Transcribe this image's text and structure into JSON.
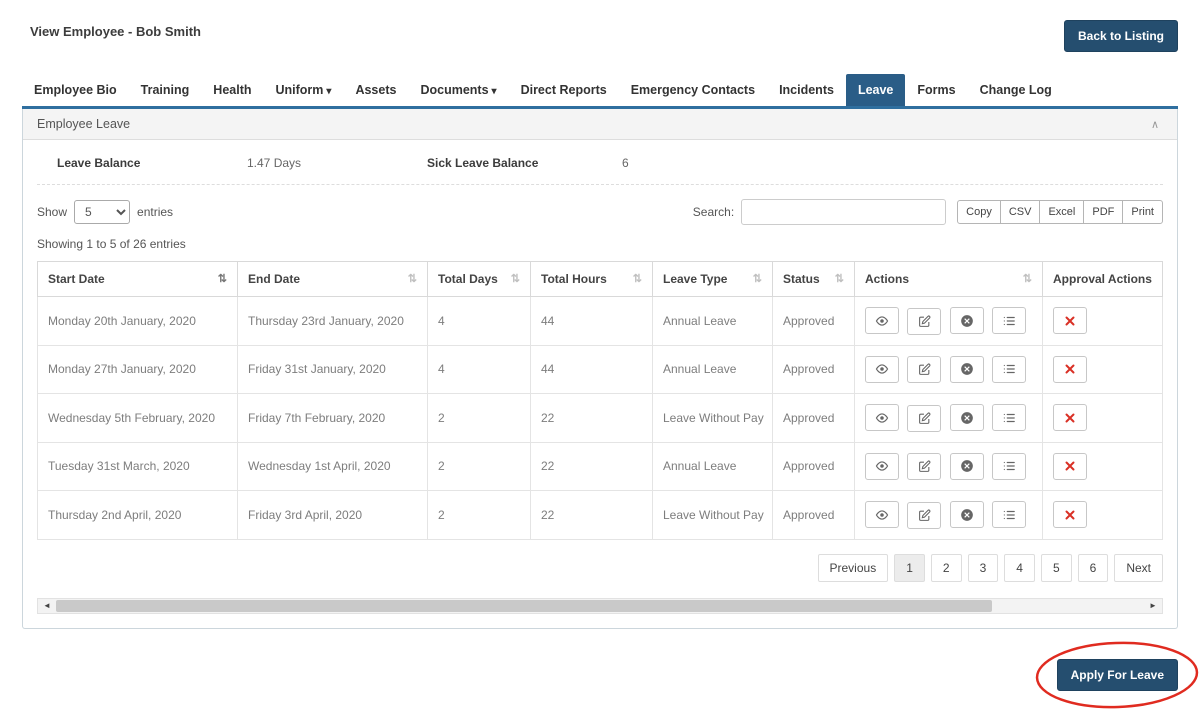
{
  "colors": {
    "navy": "#254e6f",
    "tab_active": "#2a5d87",
    "accent_blue": "#2f6f9f",
    "danger": "#d93025"
  },
  "icons": {
    "caret_down": "▾",
    "sort": "⇅",
    "collapse": "∧",
    "scroll_left": "◄",
    "scroll_right": "►"
  },
  "header": {
    "title": "View Employee - Bob Smith",
    "back_button": "Back to Listing"
  },
  "tabs": [
    {
      "label": "Employee Bio"
    },
    {
      "label": "Training"
    },
    {
      "label": "Health"
    },
    {
      "label": "Uniform"
    },
    {
      "label": "Assets"
    },
    {
      "label": "Documents"
    },
    {
      "label": "Direct Reports"
    },
    {
      "label": "Emergency Contacts"
    },
    {
      "label": "Incidents"
    },
    {
      "label": "Leave"
    },
    {
      "label": "Forms"
    },
    {
      "label": "Change Log"
    }
  ],
  "panel": {
    "title": "Employee Leave",
    "balances": {
      "leave_label": "Leave Balance",
      "leave_value": "1.47 Days",
      "sick_label": "Sick Leave Balance",
      "sick_value": "6"
    },
    "controls": {
      "show_label": "Show",
      "page_size": "5",
      "entries_label": "entries",
      "search_label": "Search:",
      "export_buttons": [
        "Copy",
        "CSV",
        "Excel",
        "PDF",
        "Print"
      ],
      "showing_text": "Showing 1 to 5 of 26 entries"
    },
    "table": {
      "headers": [
        "Start Date",
        "End Date",
        "Total Days",
        "Total Hours",
        "Leave Type",
        "Status",
        "Actions",
        "Approval Actions"
      ],
      "rows": [
        {
          "start_date": "Monday 20th January, 2020",
          "end_date": "Thursday 23rd January, 2020",
          "total_days": "4",
          "total_hours": "44",
          "leave_type": "Annual Leave",
          "status": "Approved"
        },
        {
          "start_date": "Monday 27th January, 2020",
          "end_date": "Friday 31st January, 2020",
          "total_days": "4",
          "total_hours": "44",
          "leave_type": "Annual Leave",
          "status": "Approved"
        },
        {
          "start_date": "Wednesday 5th February, 2020",
          "end_date": "Friday 7th February, 2020",
          "total_days": "2",
          "total_hours": "22",
          "leave_type": "Leave Without Pay",
          "status": "Approved"
        },
        {
          "start_date": "Tuesday 31st March, 2020",
          "end_date": "Wednesday 1st April, 2020",
          "total_days": "2",
          "total_hours": "22",
          "leave_type": "Annual Leave",
          "status": "Approved"
        },
        {
          "start_date": "Thursday 2nd April, 2020",
          "end_date": "Friday 3rd April, 2020",
          "total_days": "2",
          "total_hours": "22",
          "leave_type": "Leave Without Pay",
          "status": "Approved"
        }
      ]
    },
    "pagination": {
      "previous": "Previous",
      "pages": [
        "1",
        "2",
        "3",
        "4",
        "5",
        "6"
      ],
      "next": "Next"
    }
  },
  "footer": {
    "apply_button": "Apply For Leave"
  }
}
